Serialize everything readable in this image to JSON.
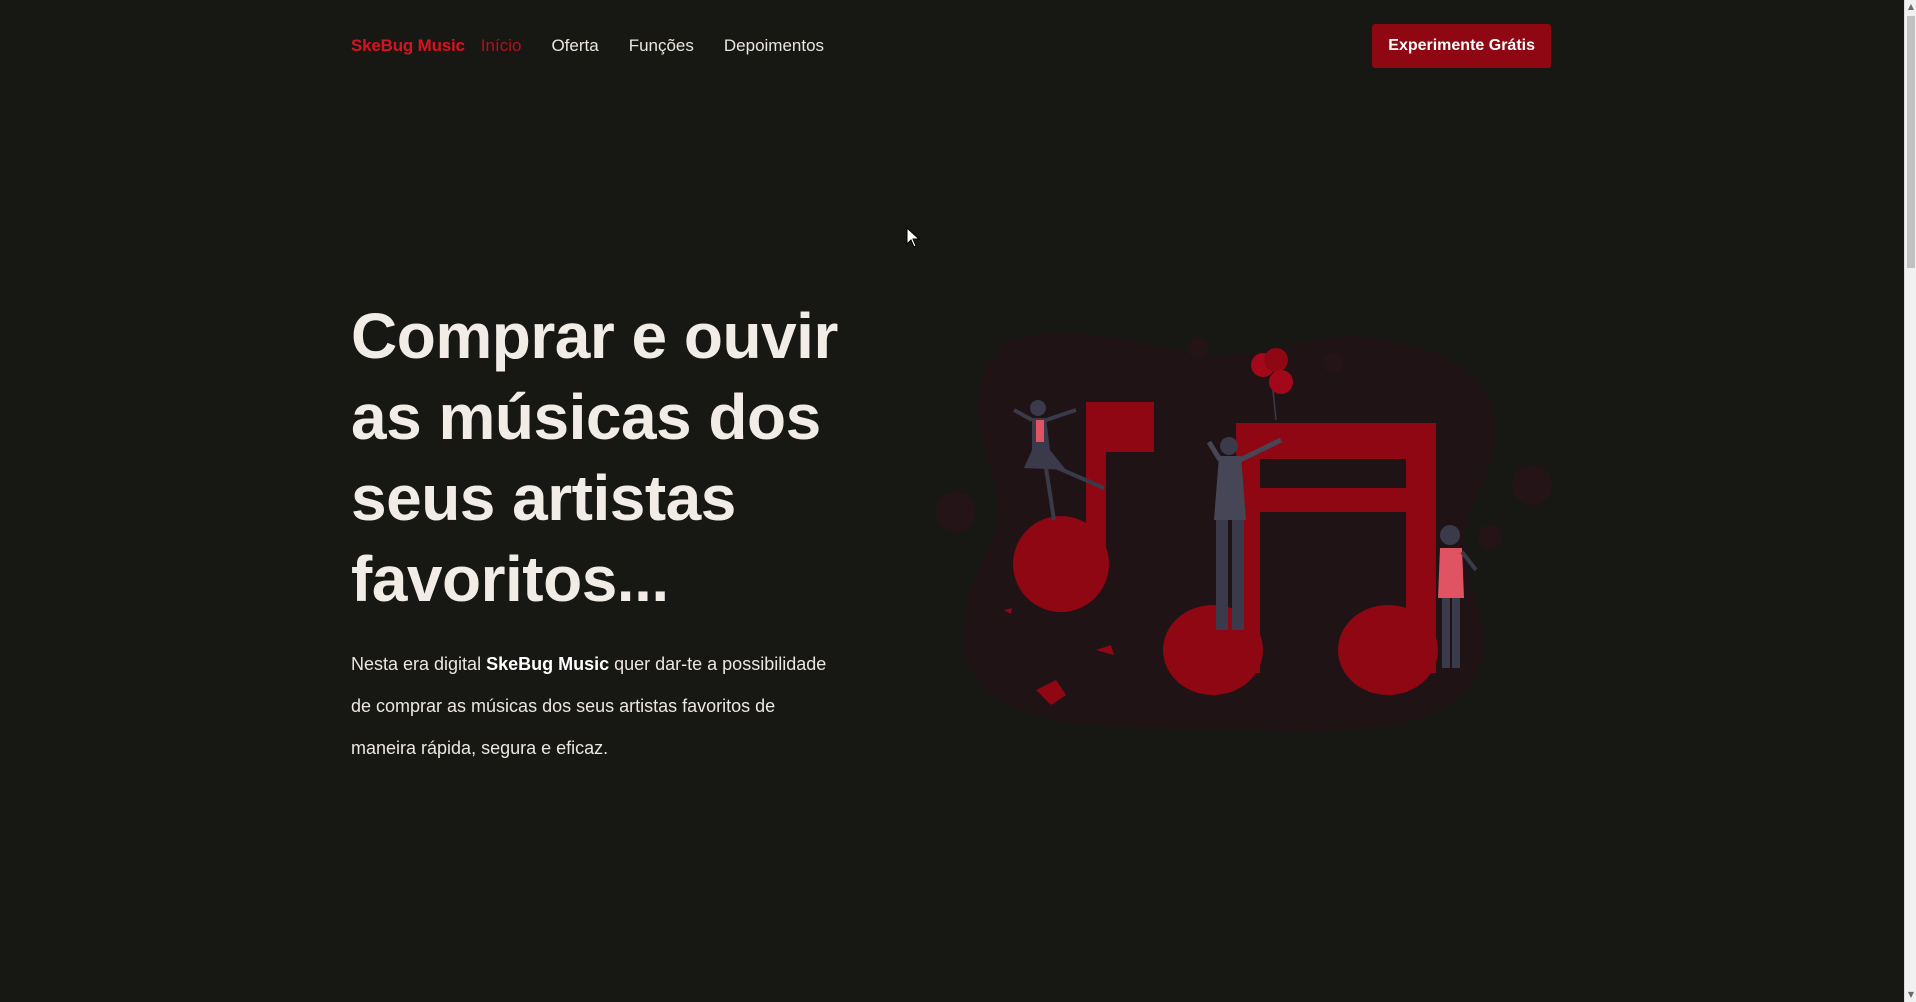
{
  "nav": {
    "brand": "SkeBug Music",
    "links": [
      {
        "label": "Início"
      },
      {
        "label": "Oferta"
      },
      {
        "label": "Funções"
      },
      {
        "label": "Depoimentos"
      }
    ],
    "cta_label": "Experimente Grátis"
  },
  "hero": {
    "title_lines": [
      "Comprar e ouvir",
      "as músicas dos",
      "seus artistas",
      "favoritos..."
    ],
    "text_before": "Nesta era digital ",
    "text_brand": "SkeBug Music",
    "text_after": " quer dar-te a possibilidade de comprar as músicas dos seus artistas favoritos de maneira rápida, segura e eficaz."
  },
  "icons": {
    "illustration": "music-notes-people-illustration",
    "cursor": "mouse-cursor-icon"
  },
  "colors": {
    "brand": "#d61420",
    "cta_bg": "#8f0712",
    "background": "#171714",
    "note_red": "#8f0712"
  }
}
